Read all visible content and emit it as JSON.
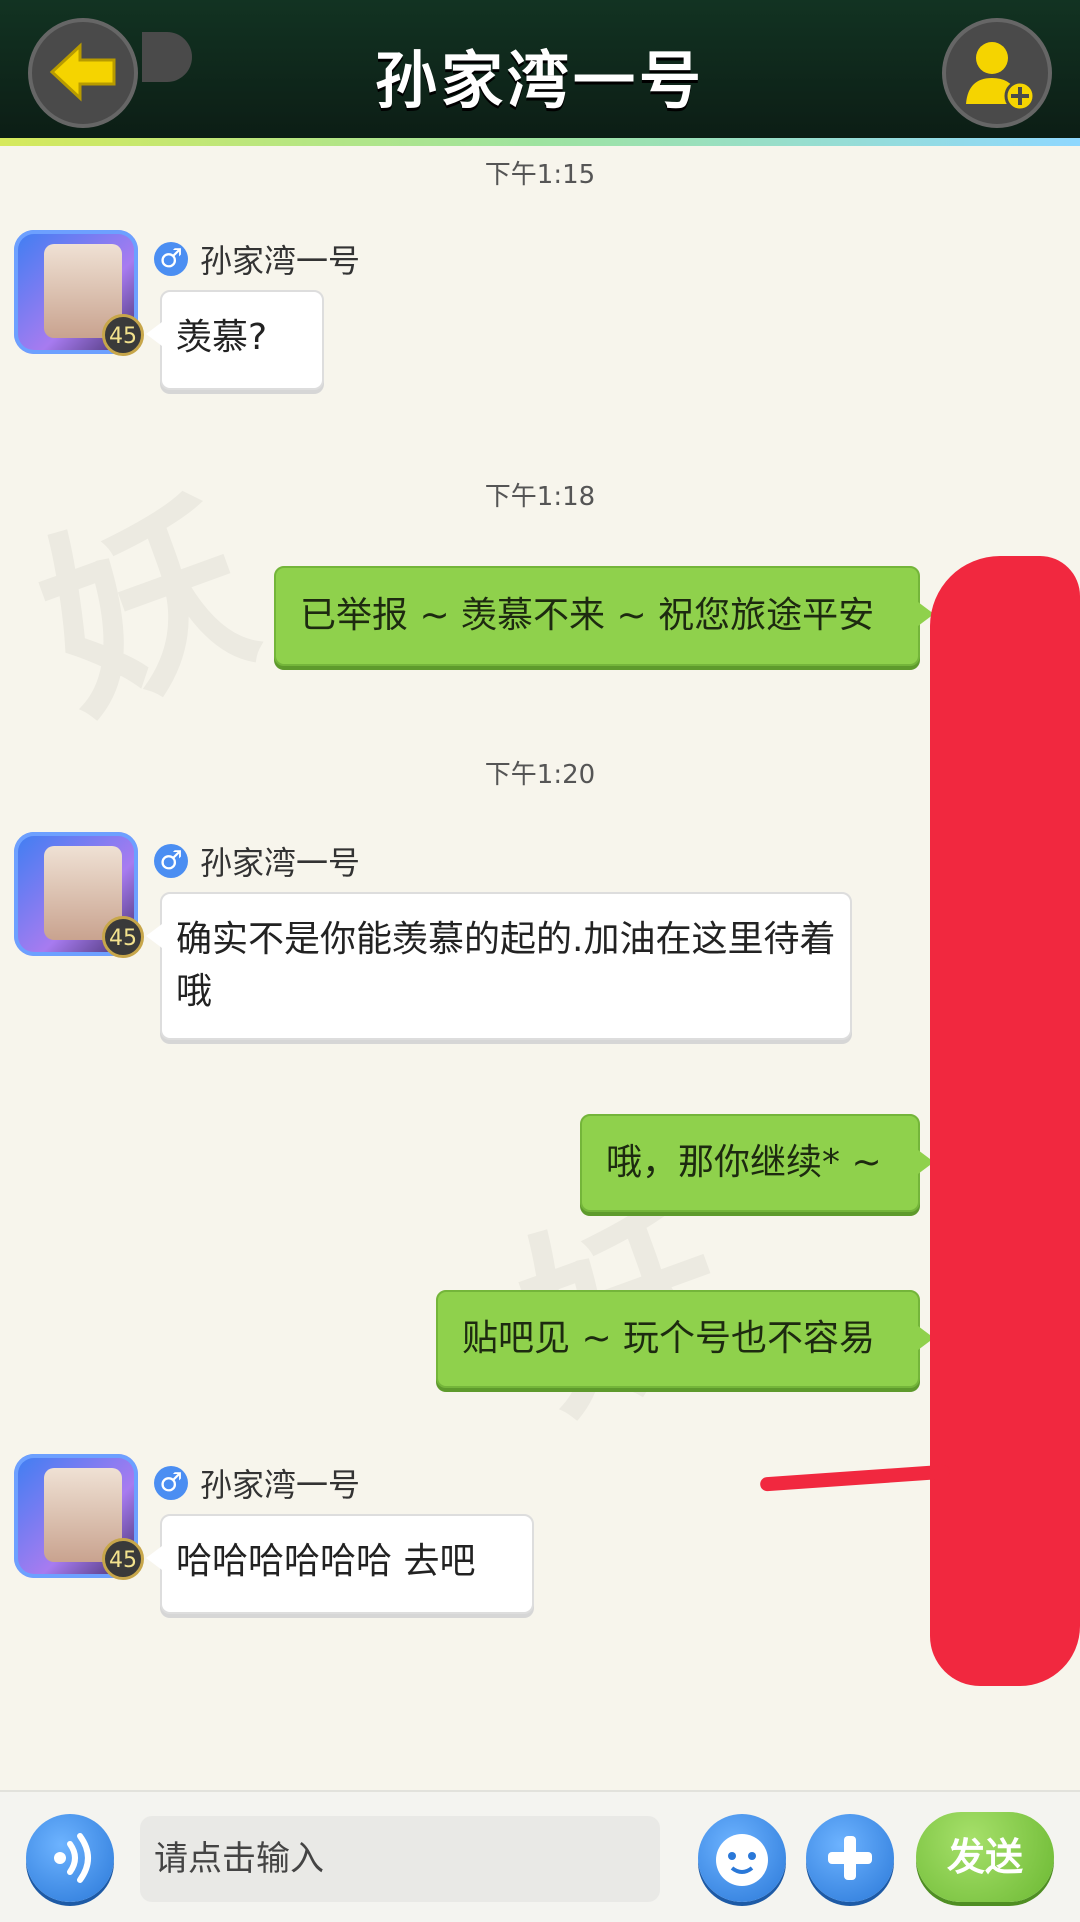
{
  "header": {
    "title": "孙家湾一号",
    "back_icon": "arrow-left-icon",
    "add_friend_icon": "add-friend-icon"
  },
  "messages": [
    {
      "timestamp": "下午1:15"
    },
    {
      "sender": "孙家湾一号",
      "level": "45",
      "gender_icon": "male-icon",
      "text": "羡慕?"
    },
    {
      "timestamp": "下午1:18"
    },
    {
      "self": true,
      "text": "已举报 ~ 羡慕不来 ~ 祝您旅途平安"
    },
    {
      "timestamp": "下午1:20"
    },
    {
      "sender": "孙家湾一号",
      "level": "45",
      "gender_icon": "male-icon",
      "text": "确实不是你能羡慕的起的.加油在这里待着哦"
    },
    {
      "self": true,
      "text": "哦，那你继续* ~"
    },
    {
      "self": true,
      "text": "贴吧见 ~ 玩个号也不容易"
    },
    {
      "sender": "孙家湾一号",
      "level": "45",
      "gender_icon": "male-icon",
      "text": "哈哈哈哈哈哈 去吧"
    }
  ],
  "input": {
    "placeholder": "请点击输入",
    "send_label": "发送",
    "voice_icon": "voice-icon",
    "emoji_icon": "emoji-icon",
    "plus_icon": "plus-icon"
  },
  "colors": {
    "header_bg": "#0f2a1c",
    "self_bubble": "#8fd14c",
    "other_bubble": "#ffffff",
    "send_button": "#7cc63d",
    "accent_blue": "#3b8ae6",
    "redaction": "#f1283f"
  }
}
